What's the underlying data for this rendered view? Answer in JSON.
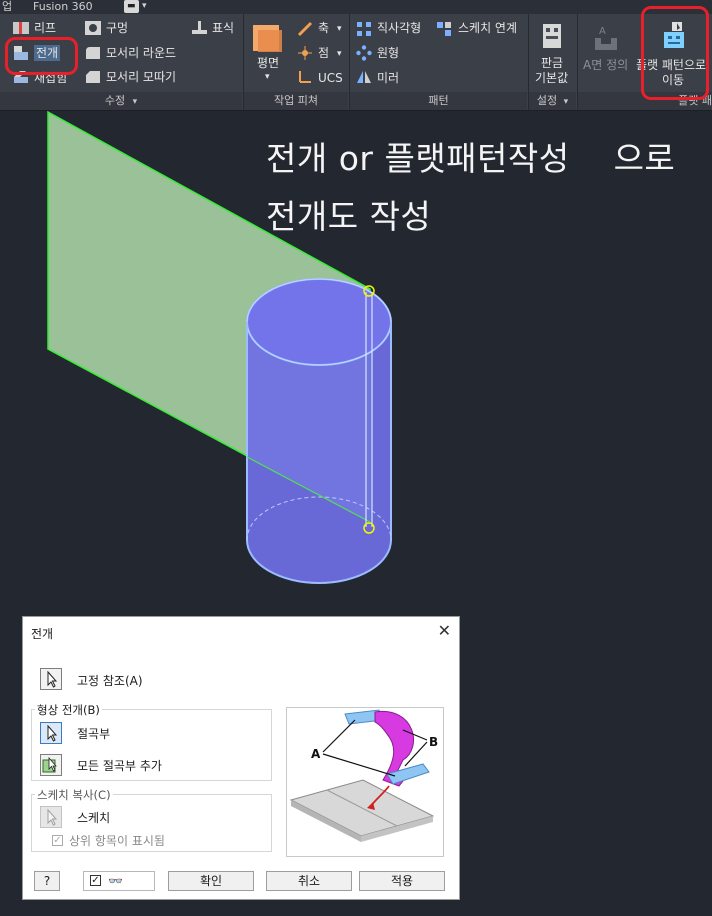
{
  "topbar": {
    "left_fragment": "업",
    "fusion": "Fusion 360",
    "menu_glyph": "▾"
  },
  "ribbon": {
    "modify": {
      "rip": "리프",
      "unfold": "전개",
      "refold": "재접힘",
      "hole": "구멍",
      "corner_round": "모서리 라운드",
      "corner_chamfer": "모서리 모따기",
      "mark": "표식",
      "group_label": "수정",
      "group_arrow": "▾"
    },
    "work_features": {
      "plane": "평면",
      "axis": "축",
      "point": "점",
      "ucs": "UCS",
      "group_label": "작업 피쳐"
    },
    "pattern": {
      "rectangular": "직사각형",
      "sketch_link": "스케치 연계",
      "circular": "원형",
      "mirror": "미러",
      "group_label": "패턴"
    },
    "setup": {
      "sheet_defaults_line1": "판금",
      "sheet_defaults_line2": "기본값",
      "group_label": "설정",
      "group_arrow": "▾"
    },
    "flat_pattern": {
      "a_side": "A면 정의",
      "goto_line1": "플랫 패턴으로",
      "goto_line2": "이동",
      "group_label": "플랫 패"
    }
  },
  "annotation": {
    "line1": "전개 or 플랫패턴작성    으로",
    "line2": "전개도 작성"
  },
  "dialog": {
    "title": "전개",
    "close": "✕",
    "fixed_ref": "고정 참조(A)",
    "shape_unfold_legend": "형상 전개(B)",
    "bends": "절곡부",
    "add_all_bends": "모든 절곡부 추가",
    "sketch_copy_legend": "스케치 복사(C)",
    "sketches": "스케치",
    "parent_visible": "상위 항목이 표시됨",
    "parent_checked": "✓",
    "preview_label_a": "A",
    "preview_label_b": "B",
    "help": "?",
    "glasses_check": "✓",
    "glasses": "👓",
    "ok": "확인",
    "cancel": "취소",
    "apply": "적용"
  },
  "colors": {
    "ribbon_bg": "#3b3f47",
    "canvas_bg": "#232730",
    "highlight_red": "#e8202a",
    "cylinder_blue": "#7070e8",
    "plane_green": "#a9d3a4"
  }
}
